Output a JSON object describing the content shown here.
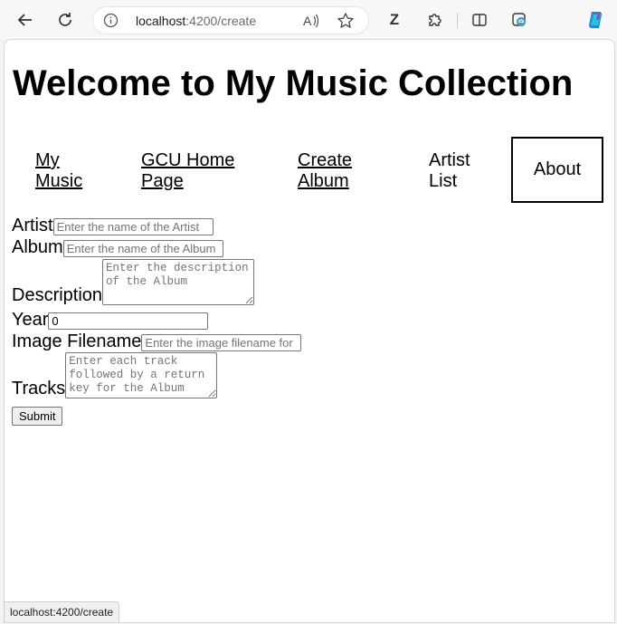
{
  "browser": {
    "url_host": "localhost",
    "url_rest": ":4200/create",
    "profile_letter": "Z",
    "status_url": "localhost:4200/create"
  },
  "page": {
    "title": "Welcome to My Music Collection"
  },
  "nav": {
    "my_music": [
      "My",
      "Music"
    ],
    "gcu_home": [
      "GCU Home",
      "Page"
    ],
    "create_album": [
      "Create",
      "Album"
    ],
    "artist_list": [
      "Artist",
      "List"
    ],
    "about": "About"
  },
  "form": {
    "artist": {
      "label": "Artist",
      "placeholder": "Enter the name of the Artist",
      "value": ""
    },
    "album": {
      "label": "Album",
      "placeholder": "Enter the name of the Album",
      "value": ""
    },
    "description": {
      "label": "Description",
      "placeholder": "Enter the description of the Album",
      "value": ""
    },
    "year": {
      "label": "Year",
      "placeholder": "",
      "value": "0"
    },
    "image": {
      "label": "Image Filename",
      "placeholder": "Enter the image filename for",
      "value": ""
    },
    "tracks": {
      "label": "Tracks",
      "placeholder": "Enter each track followed by a return key for the Album",
      "value": ""
    },
    "submit_label": "Submit"
  },
  "colors": {
    "chrome_bg": "#f7f7f7",
    "page_bg": "#ffffff",
    "text": "#000000"
  }
}
